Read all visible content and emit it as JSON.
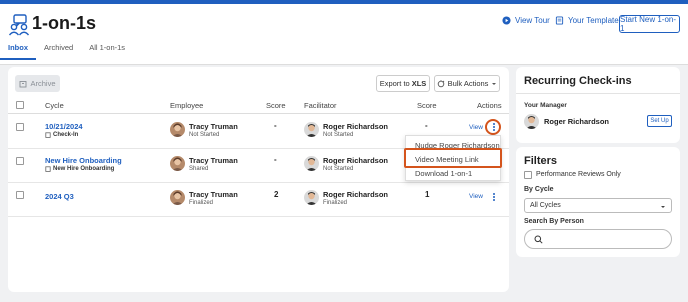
{
  "app": {
    "title": "1-on-1s"
  },
  "header": {
    "view_tour": "View Tour",
    "your_templates": "Your Templates",
    "new_button": "Start New 1-on-1"
  },
  "tabs": [
    {
      "label": "Inbox"
    },
    {
      "label": "Archived"
    },
    {
      "label": "All 1-on-1s"
    }
  ],
  "toolbar": {
    "archive": "Archive",
    "export": "Export to",
    "export_bold": "XLS",
    "bulk": "Bulk Actions"
  },
  "table": {
    "headers": {
      "cycle": "Cycle",
      "employee": "Employee",
      "score1": "Score",
      "facilitator": "Facilitator",
      "score2": "Score",
      "actions": "Actions"
    },
    "rows": [
      {
        "cycle": "10/21/2024",
        "cycle_type": "Check-In",
        "employee": "Tracy Truman",
        "employee_status": "Not Started",
        "score1": "-",
        "facilitator": "Roger Richardson",
        "facilitator_status": "Not Started",
        "score2": "-",
        "view": "View"
      },
      {
        "cycle": "New Hire Onboarding",
        "cycle_type": "New Hire Onboarding",
        "employee": "Tracy Truman",
        "employee_status": "Shared",
        "score1": "-",
        "facilitator": "Roger Richardson",
        "facilitator_status": "Not Started",
        "score2": "",
        "view": ""
      },
      {
        "cycle": "2024 Q3",
        "cycle_type": "",
        "employee": "Tracy Truman",
        "employee_status": "Finalized",
        "score1": "2",
        "facilitator": "Roger Richardson",
        "facilitator_status": "Finalized",
        "score2": "1",
        "view": "View"
      }
    ]
  },
  "menu": {
    "items": [
      "Nudge Roger Richardson",
      "Video Meeting Link",
      "Download 1-on-1"
    ]
  },
  "recurring": {
    "title": "Recurring Check-ins",
    "manager_label": "Your Manager",
    "manager_name": "Roger Richardson",
    "setup": "Set Up"
  },
  "filters": {
    "title": "Filters",
    "perf_reviews": "Performance Reviews Only",
    "by_cycle": "By Cycle",
    "cycle_value": "All Cycles",
    "by_person": "Search By Person"
  },
  "colors": {
    "accent": "#1f5fbf",
    "highlight": "#d4541c"
  }
}
